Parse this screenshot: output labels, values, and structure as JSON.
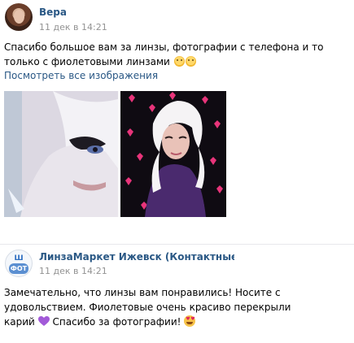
{
  "comments": [
    {
      "author": "Вера",
      "date": "11 дек в 14:21",
      "text_line1": "Спасибо большое вам за линзы, фотографии с телефона и то",
      "text_line2": "только с фиолетовыми линзами",
      "emoji": [
        "smiling-face",
        "smiling-face"
      ],
      "link": "Посмотреть все изображения",
      "photos": [
        "photo-1",
        "photo-2"
      ]
    },
    {
      "author": "ЛинзаМаркет Ижевск (Контактные ли...",
      "date": "11 дек в 14:21",
      "text_line1": "Замечательно, что линзы вам понравились! Носите с",
      "text_line2": "удовольствием. Фиолетовые очень красиво перекрыли",
      "text_line3_a": "карий",
      "text_line3_b": "Спасибо за фотографии!",
      "emoji": [
        "purple-heart",
        "heart-eyes-smile"
      ],
      "avatar_text_top": "Ш",
      "avatar_text_bottom": "ФОТ"
    }
  ],
  "colors": {
    "link": "#2a5885",
    "meta": "#939393",
    "text": "#000000"
  }
}
